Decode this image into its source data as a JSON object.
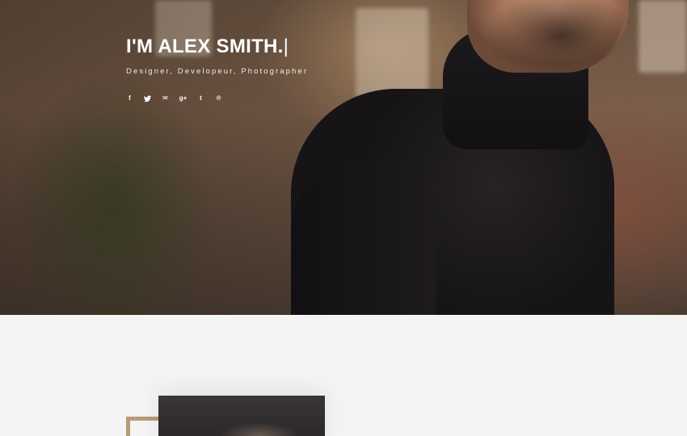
{
  "hero": {
    "title": "I'M ALEX SMITH.",
    "cursor": "|",
    "subtitle": "Designer, Developeur, Photographer",
    "social_icons": [
      {
        "name": "facebook-icon",
        "glyph": "f"
      },
      {
        "name": "twitter-icon",
        "glyph": "🐦"
      },
      {
        "name": "mail-icon",
        "glyph": "✉"
      },
      {
        "name": "google-plus-icon",
        "glyph": "g+"
      },
      {
        "name": "tumblr-icon",
        "glyph": "t"
      },
      {
        "name": "pinterest-icon",
        "glyph": "℗"
      }
    ]
  },
  "about": {
    "text_line": ""
  },
  "colors": {
    "accent": "#b89a78",
    "section_bg": "#f4f4f4",
    "hero_text": "#ffffff"
  }
}
